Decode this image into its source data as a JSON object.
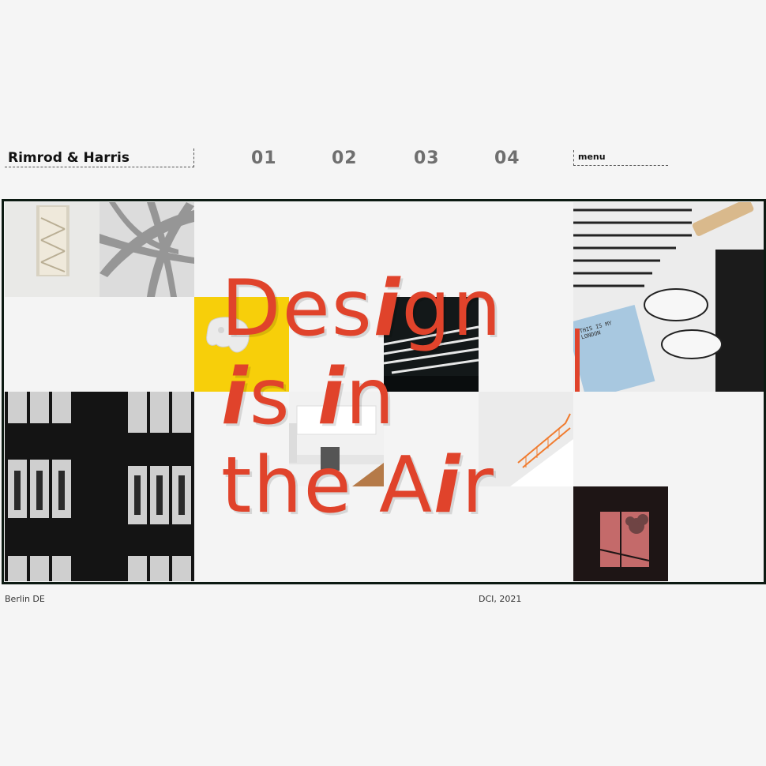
{
  "header": {
    "brand": "Rimrod & Harris",
    "nav": [
      "01",
      "02",
      "03",
      "04"
    ],
    "menu_label": "menu"
  },
  "hero": {
    "line1": {
      "a": "Des",
      "b": "i",
      "c": "gn"
    },
    "line2": {
      "a": "i",
      "b": "s ",
      "c": "i",
      "d": "n"
    },
    "line3": {
      "a": "the A",
      "b": "i",
      "c": "r"
    },
    "notebook_text": "THIS IS MY LONDON"
  },
  "footer": {
    "location": "Berlin DE",
    "credit": "DCI, 2021"
  },
  "colors": {
    "accent": "#e0432b",
    "yellow": "#f7cf0a",
    "frame_border": "#0c1a12",
    "background": "#f5f5f5"
  }
}
